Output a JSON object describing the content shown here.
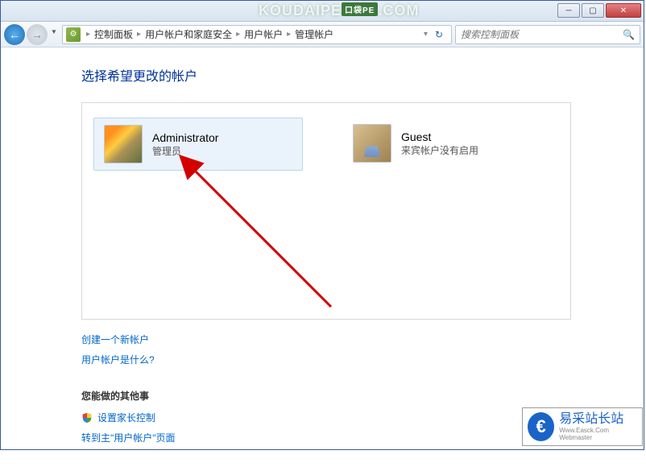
{
  "breadcrumb": {
    "items": [
      "控制面板",
      "用户帐户和家庭安全",
      "用户帐户",
      "管理帐户"
    ]
  },
  "search": {
    "placeholder": "搜索控制面板"
  },
  "heading": "选择希望更改的帐户",
  "accounts": [
    {
      "name": "Administrator",
      "sub": "管理员"
    },
    {
      "name": "Guest",
      "sub": "来宾帐户没有启用"
    }
  ],
  "links": {
    "create": "创建一个新帐户",
    "whatis": "用户帐户是什么?"
  },
  "other": {
    "heading": "您能做的其他事",
    "parental": "设置家长控制",
    "goto_main": "转到主\"用户帐户\"页面"
  },
  "watermark_top": {
    "text": "KOUDAIPE",
    "badge": "口袋PE",
    "dotcom": ".COM"
  },
  "watermark_logo": {
    "text": "易采站长站",
    "sub": "Www.Easck.Com Webmaster"
  }
}
